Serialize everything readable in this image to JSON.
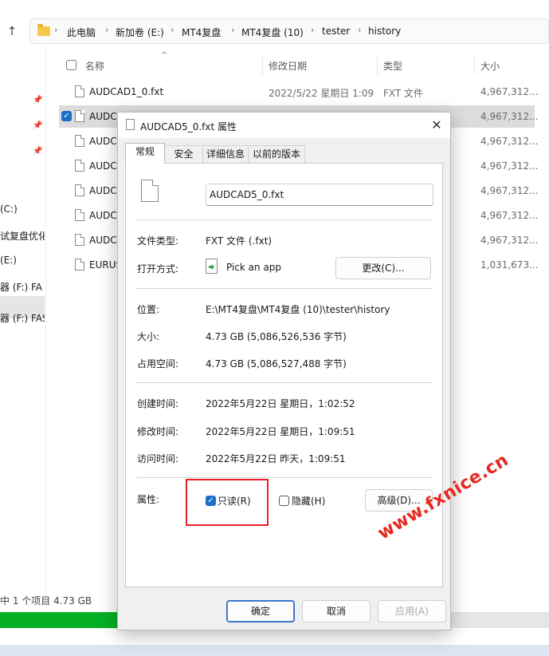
{
  "breadcrumb": [
    "此电脑",
    "新加卷 (E:)",
    "MT4复盘",
    "MT4复盘 (10)",
    "tester",
    "history"
  ],
  "nav": {
    "items": [
      "(C:)",
      "试复盘优化",
      "(E:)",
      "器 (F:) FA",
      "器 (F:) FAST"
    ]
  },
  "columns": {
    "name": "名称",
    "date": "修改日期",
    "type": "类型",
    "size": "大小"
  },
  "files": [
    {
      "name": "AUDCAD1_0.fxt",
      "date": "2022/5/22 星期日 1:09",
      "type": "FXT 文件",
      "size": "4,967,312..."
    },
    {
      "name": "AUDCA",
      "date": "",
      "type": "",
      "size": "4,967,312..."
    },
    {
      "name": "AUDCA",
      "date": "",
      "type": "",
      "size": "4,967,312..."
    },
    {
      "name": "AUDCA",
      "date": "",
      "type": "",
      "size": "4,967,312..."
    },
    {
      "name": "AUDCA",
      "date": "",
      "type": "",
      "size": "4,967,312..."
    },
    {
      "name": "AUDCA",
      "date": "",
      "type": "",
      "size": "4,967,312..."
    },
    {
      "name": "AUDCA",
      "date": "",
      "type": "",
      "size": "4,967,312..."
    },
    {
      "name": "EURUS",
      "date": "",
      "type": "",
      "size": "1,031,673..."
    }
  ],
  "status": {
    "text": "中 1 个项目   4.73 GB"
  },
  "progress": {
    "fraction": 0.82,
    "color": "#06b025"
  },
  "dialog": {
    "title": "AUDCAD5_0.fxt 属性",
    "tabs": [
      "常规",
      "安全",
      "详细信息",
      "以前的版本"
    ],
    "filename": "AUDCAD5_0.fxt",
    "file_type_label": "文件类型:",
    "file_type_value": "FXT 文件 (.fxt)",
    "open_with_label": "打开方式:",
    "open_with_value": "Pick an app",
    "change_button": "更改(C)...",
    "location_label": "位置:",
    "location_value": "E:\\MT4复盘\\MT4复盘 (10)\\tester\\history",
    "size_label": "大小:",
    "size_value": "4.73 GB (5,086,526,536 字节)",
    "size_on_disk_label": "占用空间:",
    "size_on_disk_value": "4.73 GB (5,086,527,488 字节)",
    "created_label": "创建时间:",
    "created_value": "2022年5月22日 星期日，1:02:52",
    "modified_label": "修改时间:",
    "modified_value": "2022年5月22日 星期日，1:09:51",
    "accessed_label": "访问时间:",
    "accessed_value": "2022年5月22日 昨天，1:09:51",
    "attributes_label": "属性:",
    "readonly_label": "只读(R)",
    "readonly_checked": true,
    "hidden_label": "隐藏(H)",
    "hidden_checked": false,
    "advanced_button": "高级(D)...",
    "ok_button": "确定",
    "cancel_button": "取消",
    "apply_button": "应用(A)"
  },
  "watermark": "www.fxnice.cn",
  "colors": {
    "accent": "#1a6fc9",
    "highlight_box": "#e8202a",
    "watermark": "#e42a1f"
  }
}
